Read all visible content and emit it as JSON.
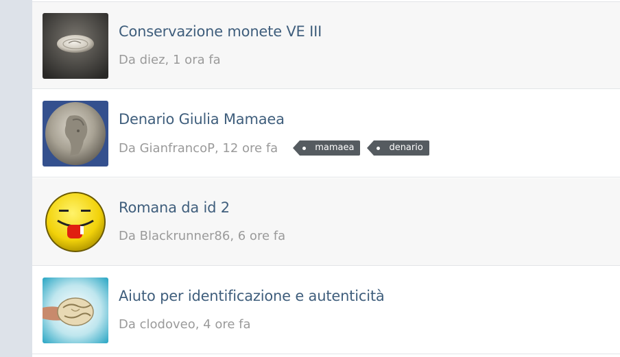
{
  "topics": [
    {
      "title": "Conservazione monete VE III",
      "meta": "Da diez, 1 ora fa",
      "thumb_icon": "coin-photo-icon",
      "tags": []
    },
    {
      "title": "Denario Giulia Mamaea",
      "meta": "Da GianfrancoP, 12 ore fa",
      "thumb_icon": "roman-denarius-photo-icon",
      "tags": [
        "mamaea",
        "denario"
      ]
    },
    {
      "title": "Romana da id 2",
      "meta": "Da Blackrunner86, 6 ore fa",
      "thumb_icon": "tongue-out-emoji-avatar-icon",
      "tags": []
    },
    {
      "title": "Aiuto per identificazione e autenticità",
      "meta": "Da clodoveo, 4 ore fa",
      "thumb_icon": "coin-in-hand-photo-icon",
      "tags": []
    }
  ],
  "colors": {
    "title": "#3f5e7c",
    "meta": "#9a9a9a",
    "tag_bg": "#555b60",
    "row_alt": "#f7f7f7",
    "gutter": "#dde2e9"
  }
}
